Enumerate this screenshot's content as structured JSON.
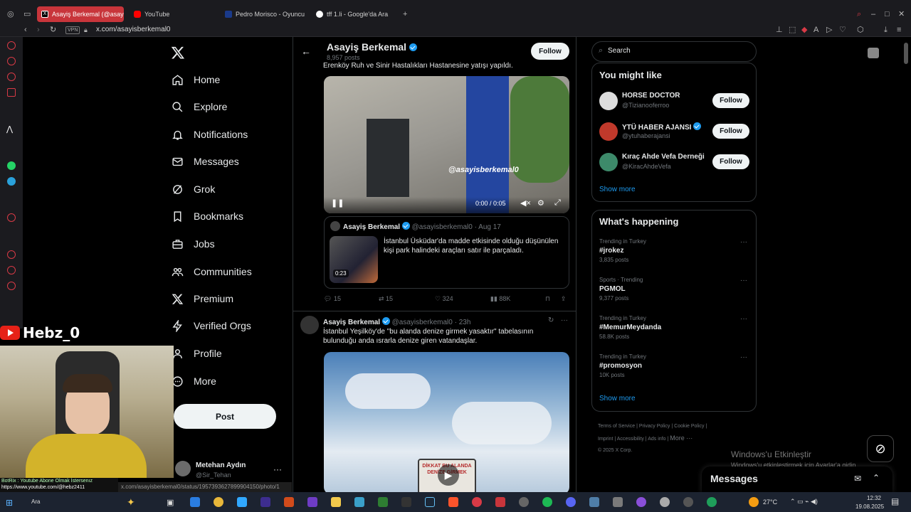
{
  "browser": {
    "tabs": [
      {
        "label": "Asayiş Berkemal (@asay",
        "active": true
      },
      {
        "label": "YouTube"
      },
      {
        "label": "Pedro Morisco - Oyuncu"
      },
      {
        "label": "tff 1.li - Google'da Ara"
      }
    ],
    "vpn_label": "VPN",
    "url": "x.com/asayisberkemal0"
  },
  "nav": {
    "items": [
      "Home",
      "Explore",
      "Notifications",
      "Messages",
      "Grok",
      "Bookmarks",
      "Jobs",
      "Communities",
      "Premium",
      "Verified Orgs",
      "Profile",
      "More"
    ],
    "post_label": "Post",
    "account_name": "Metehan Aydın",
    "account_handle": "@Sir_Tehan",
    "more_dots": "···"
  },
  "header": {
    "name": "Asayiş Berkemal",
    "post_count": "8,957 posts",
    "follow_label": "Follow"
  },
  "tweet1": {
    "text_top": "Erenköy Ruh ve Sinir Hastalıkları Hastanesine yatışı yapıldı.",
    "video_time": "0:00 / 0:05",
    "video_watermark": "@asayisberkemal0",
    "quote": {
      "name": "Asayiş Berkemal",
      "handle": "@asayisberkemal0",
      "date": "· Aug 17",
      "text": "İstanbul Üsküdar'da madde etkisinde olduğu düşünülen kişi park halindeki araçları satır ile parçaladı.",
      "thumb_duration": "0:23"
    },
    "stats": {
      "replies": "15",
      "reposts": "15",
      "likes": "324",
      "views": "88K"
    }
  },
  "tweet2": {
    "name": "Asayiş Berkemal",
    "handle": "@asayisberkemal0",
    "time": "· 23h",
    "text": "İstanbul Yeşilköy'de \"bu alanda denize girmek yasaktır\" tabelasının bulunduğu anda ısrarla denize giren vatandaşlar.",
    "sign_text": "DİKKAT BU ALANDA DENİZE GİRMEK"
  },
  "search": {
    "placeholder": "Search"
  },
  "suggestions": {
    "title": "You might like",
    "items": [
      {
        "name": "HORSE DOCTOR",
        "handle": "@Tizianooferroo",
        "follow": "Follow"
      },
      {
        "name": "YTÜ HABER AJANSI",
        "handle": "@ytuhaberajansi",
        "follow": "Follow"
      },
      {
        "name": "Kıraç Ahde Vefa Derneği",
        "handle": "@KiracAhdeVefa",
        "follow": "Follow"
      }
    ],
    "show_more": "Show more"
  },
  "happening": {
    "title": "What's happening",
    "trends": [
      {
        "context": "Trending in Turkey",
        "name": "#jrokez",
        "count": "3,835 posts"
      },
      {
        "context": "Sports · Trending",
        "name": "PGMOL",
        "count": "9,377 posts"
      },
      {
        "context": "Trending in Turkey",
        "name": "#MemurMeydanda",
        "count": "58.8K posts"
      },
      {
        "context": "Trending in Turkey",
        "name": "#promosyon",
        "count": "10K posts"
      }
    ],
    "show_more": "Show more"
  },
  "footer": {
    "links": [
      "Terms of Service",
      "Privacy Policy",
      "Cookie Policy",
      "Imprint",
      "Accessibility",
      "Ads info",
      "More ···"
    ],
    "copyright": "© 2025 X Corp."
  },
  "windows_activation": {
    "title": "Windows'u Etkinleştir",
    "subtitle": "Windows'u etkinleştirmek için Ayarlar'a gidin."
  },
  "messages_dock": {
    "label": "Messages"
  },
  "stream_overlay": {
    "channel": "Hebz_0",
    "bot_line1": "BotRix : Youtube Abone Olmak İstersenız",
    "bot_line2": "https://www.youtube.com/@hebz2411",
    "status_url": "x.com/asayisberkemal0/status/1957393627899904150/photo/1"
  },
  "taskbar": {
    "search_label": "Ara",
    "weather": "27°C",
    "time": "12:32",
    "date": "19.08.2025"
  }
}
